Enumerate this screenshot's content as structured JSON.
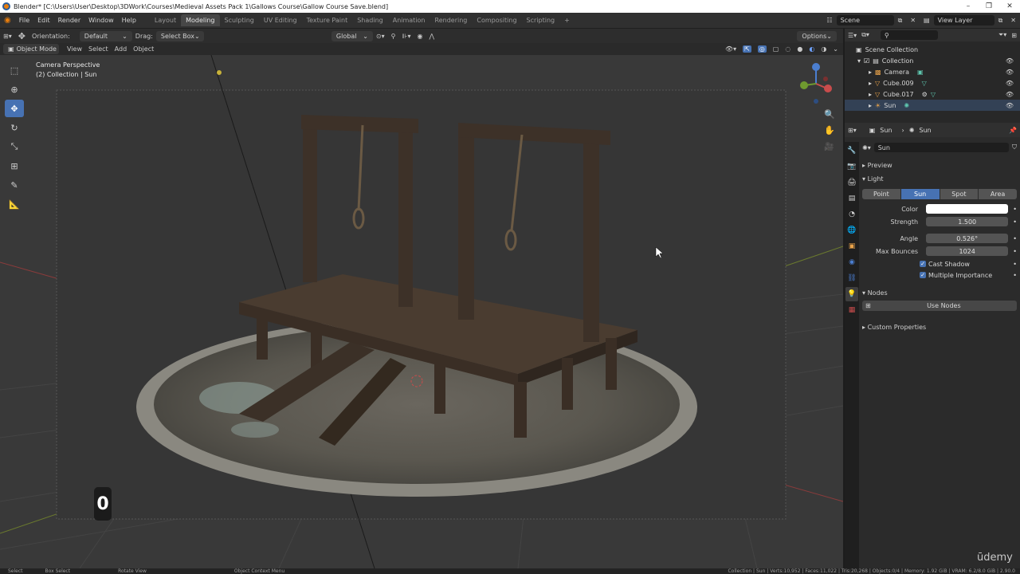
{
  "window": {
    "title": "Blender* [C:\\Users\\User\\Desktop\\3DWork\\Courses\\Medieval Assets Pack 1\\Gallows Course\\Gallow Course Save.blend]",
    "controls": [
      "–",
      "❐",
      "✕"
    ]
  },
  "menu": [
    "File",
    "Edit",
    "Render",
    "Window",
    "Help"
  ],
  "workspaces": [
    "Layout",
    "Modeling",
    "Sculpting",
    "UV Editing",
    "Texture Paint",
    "Shading",
    "Animation",
    "Rendering",
    "Compositing",
    "Scripting"
  ],
  "active_workspace": "Modeling",
  "scene": {
    "name": "Scene",
    "view_layer": "View Layer"
  },
  "tool_header": {
    "orientation_label": "Orientation:",
    "orientation_value": "Default",
    "drag_label": "Drag:",
    "drag_value": "Select Box",
    "transform_orientation": "Global",
    "options": "Options"
  },
  "viewport_header": {
    "mode": "Object Mode",
    "menus": [
      "View",
      "Select",
      "Add",
      "Object"
    ]
  },
  "viewport": {
    "view_name": "Camera Perspective",
    "collection_info": "(2) Collection | Sun",
    "key_overlay": "0",
    "watermark": "ūdemy"
  },
  "outliner": {
    "root": "Scene Collection",
    "collection": "Collection",
    "items": [
      {
        "name": "Camera",
        "icon": "camera-icon"
      },
      {
        "name": "Cube.009",
        "icon": "mesh-icon"
      },
      {
        "name": "Cube.017",
        "icon": "mesh-icon"
      },
      {
        "name": "Sun",
        "icon": "sun-icon"
      }
    ]
  },
  "properties": {
    "breadcrumb_object": "Sun",
    "breadcrumb_data": "Sun",
    "datablock": "Sun",
    "preview_label": "Preview",
    "light_label": "Light",
    "light_types": [
      "Point",
      "Sun",
      "Spot",
      "Area"
    ],
    "active_light_type": "Sun",
    "color_label": "Color",
    "color_value": "#ffffff",
    "strength_label": "Strength",
    "strength_value": "1.500",
    "angle_label": "Angle",
    "angle_value": "0.526°",
    "max_bounces_label": "Max Bounces",
    "max_bounces_value": "1024",
    "cast_shadow": "Cast Shadow",
    "multiple_importance": "Multiple Importance",
    "nodes_label": "Nodes",
    "use_nodes": "Use Nodes",
    "custom_properties": "Custom Properties"
  },
  "status": {
    "left": [
      "Select",
      "Box Select",
      "Rotate View",
      "Object Context Menu"
    ],
    "right": "Collection | Sun | Verts:10,952 | Faces:11,022 | Tris:20,268 | Objects:0/4 | Memory: 1.92 GiB | VRAM: 6.2/8.0 GiB | 2.90.0"
  },
  "colors": {
    "accent": "#4772b3",
    "header": "#303030",
    "viewport_bg": "#393939",
    "panel": "#2b2b2b"
  }
}
